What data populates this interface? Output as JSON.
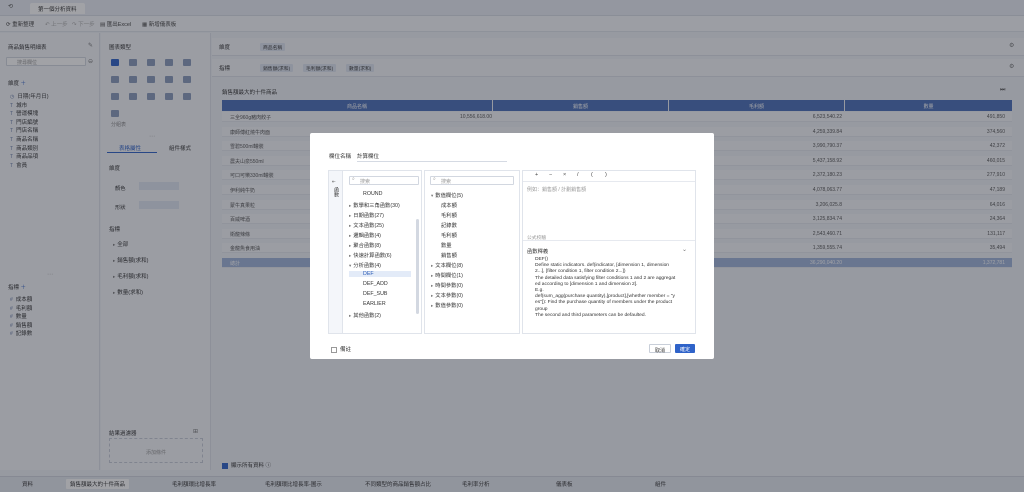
{
  "title_tab": "第一個分析資料",
  "toolbar": {
    "refresh": "重新整理",
    "prev": "上一步",
    "next": "下一步",
    "export": "匯出Excel",
    "new_dashboard": "新增儀表板"
  },
  "left_panel": {
    "section": "商品銷售明細表",
    "search_placeholder": "搜尋欄位",
    "dim_title": "維度",
    "dimensions": [
      "日期(年月日)",
      "城市",
      "營運模塊",
      "門店編號",
      "門店名稱",
      "商品名稱",
      "商品類別",
      "商品品項",
      "會員"
    ],
    "metric_title": "指標",
    "metrics": [
      "成本額",
      "毛利額",
      "數量",
      "銷售額",
      "記錄數"
    ]
  },
  "mid_panel": {
    "title": "圖表類型",
    "chart_label": "分組表",
    "tab_attr": "表格屬性",
    "tab_style": "組件樣式",
    "dim_section": "維度",
    "color": "顏色",
    "shape": "形狀",
    "metric_section": "指標",
    "metric_items": [
      "全部",
      "銷售額(求和)",
      "毛利額(求和)",
      "數量(求和)"
    ],
    "result_filter": "結果過濾器",
    "add_condition": "添加條件"
  },
  "filters": {
    "dim_label": "維度",
    "dim_chip": "商品名稱",
    "metric_label": "指標",
    "metric_chips": [
      "銷售額(求和)",
      "毛利額(求和)",
      "數量(求和)"
    ]
  },
  "table": {
    "title": "銷售額最大的十件商品",
    "headers": [
      "商品名稱",
      "銷售額",
      "毛利額",
      "數量"
    ],
    "rows": [
      [
        "三全960g豬肉餃子",
        "10,556,618.00",
        "6,523,540.22",
        "491,850"
      ],
      [
        "康師傅紅燒牛肉面",
        "",
        "4,259,339.84",
        "374,560"
      ],
      [
        "雪碧500ml罐裝",
        "",
        "3,990,790.37",
        "42,372"
      ],
      [
        "農夫山泉550ml",
        "",
        "5,437,158.92",
        "460,015"
      ],
      [
        "可口可樂330ml罐裝",
        "",
        "2,372,180.23",
        "277,910"
      ],
      [
        "伊利純牛奶",
        "",
        "4,078,063.77",
        "47,189"
      ],
      [
        "蒙牛真果粒",
        "",
        "3,206,025.8",
        "64,016"
      ],
      [
        "百威啤酒",
        "",
        "3,125,834.74",
        "24,364"
      ],
      [
        "衛龍辣條",
        "",
        "2,543,460.71",
        "131,117"
      ],
      [
        "金龍魚食用油",
        "",
        "1,359,555.74",
        "35,494"
      ]
    ],
    "total_label": "總計",
    "total": [
      "",
      "36,290,040.20",
      "1,372,781"
    ]
  },
  "dialog": {
    "field_name_label": "欄位名稱",
    "field_name_value": "計算欄位",
    "side_label": "函數",
    "search1_placeholder": "搜索",
    "search2_placeholder": "搜索",
    "functions": [
      {
        "t": "ROUND",
        "indent": 1,
        "caret": false
      },
      {
        "t": "數學和三角函數(30)",
        "indent": 0,
        "caret": true
      },
      {
        "t": "日期函數(27)",
        "indent": 0,
        "caret": true
      },
      {
        "t": "文本函數(25)",
        "indent": 0,
        "caret": true
      },
      {
        "t": "邏輯函數(4)",
        "indent": 0,
        "caret": true
      },
      {
        "t": "聚合函數(8)",
        "indent": 0,
        "caret": true
      },
      {
        "t": "快速計算函數(6)",
        "indent": 0,
        "caret": true
      },
      {
        "t": "分析函數(4)",
        "indent": 0,
        "caret": true
      },
      {
        "t": "DEF",
        "indent": 1,
        "caret": false
      },
      {
        "t": "DEF_ADD",
        "indent": 1,
        "caret": false
      },
      {
        "t": "DEF_SUB",
        "indent": 1,
        "caret": false
      },
      {
        "t": "EARLIER",
        "indent": 1,
        "caret": false
      },
      {
        "t": "其他函數(2)",
        "indent": 0,
        "caret": true
      }
    ],
    "fields": [
      {
        "t": "數值欄位(5)",
        "indent": 0
      },
      {
        "t": "成本額",
        "indent": 1
      },
      {
        "t": "毛利額",
        "indent": 1
      },
      {
        "t": "記錄數",
        "indent": 1
      },
      {
        "t": "毛利額",
        "indent": 1
      },
      {
        "t": "數量",
        "indent": 1
      },
      {
        "t": "銷售額",
        "indent": 1
      },
      {
        "t": "文本欄位(8)",
        "indent": 0
      },
      {
        "t": "時間欄位(1)",
        "indent": 0
      },
      {
        "t": "時間參數(0)",
        "indent": 0
      },
      {
        "t": "文本參數(0)",
        "indent": 0
      },
      {
        "t": "數值參數(0)",
        "indent": 0
      }
    ],
    "operators": [
      "+",
      "−",
      "×",
      "/",
      "(",
      ")"
    ],
    "editor_placeholder": "例如：銷售額 / 計劃銷售額",
    "formula_hint": "公式校驗",
    "help_title": "函數釋義",
    "help_lines": [
      "DEF()",
      "Define static indicators. def(indicator, [dimension 1, dimension",
      "2...], [filter condition 1, filter condition 2...])",
      "The detailed data satisfying filter conditions 1 and 2 are aggregat",
      "ed according to [dimension 1 and dimension 2].",
      "E.g.",
      "def(sum_agg(purchase quantity),[product],[whether member = \"y",
      "es\"]): Find the purchase quantity of members under the product",
      "group",
      "The second and third parameters can be defaulted."
    ],
    "remark": "備註",
    "cancel": "取消",
    "ok": "確定"
  },
  "bottom_tabs": [
    "資料",
    "銷售額最大的十件商品",
    "毛利額環比增長率",
    "毛利額環比增長率-圖示",
    "不同類型的商品銷售額占比",
    "毛利率分析",
    "儀表板",
    "組件"
  ],
  "footer_check": "顯示所有資料",
  "colors": {
    "primary": "#2f63c9",
    "header": "#4b6fb8"
  }
}
